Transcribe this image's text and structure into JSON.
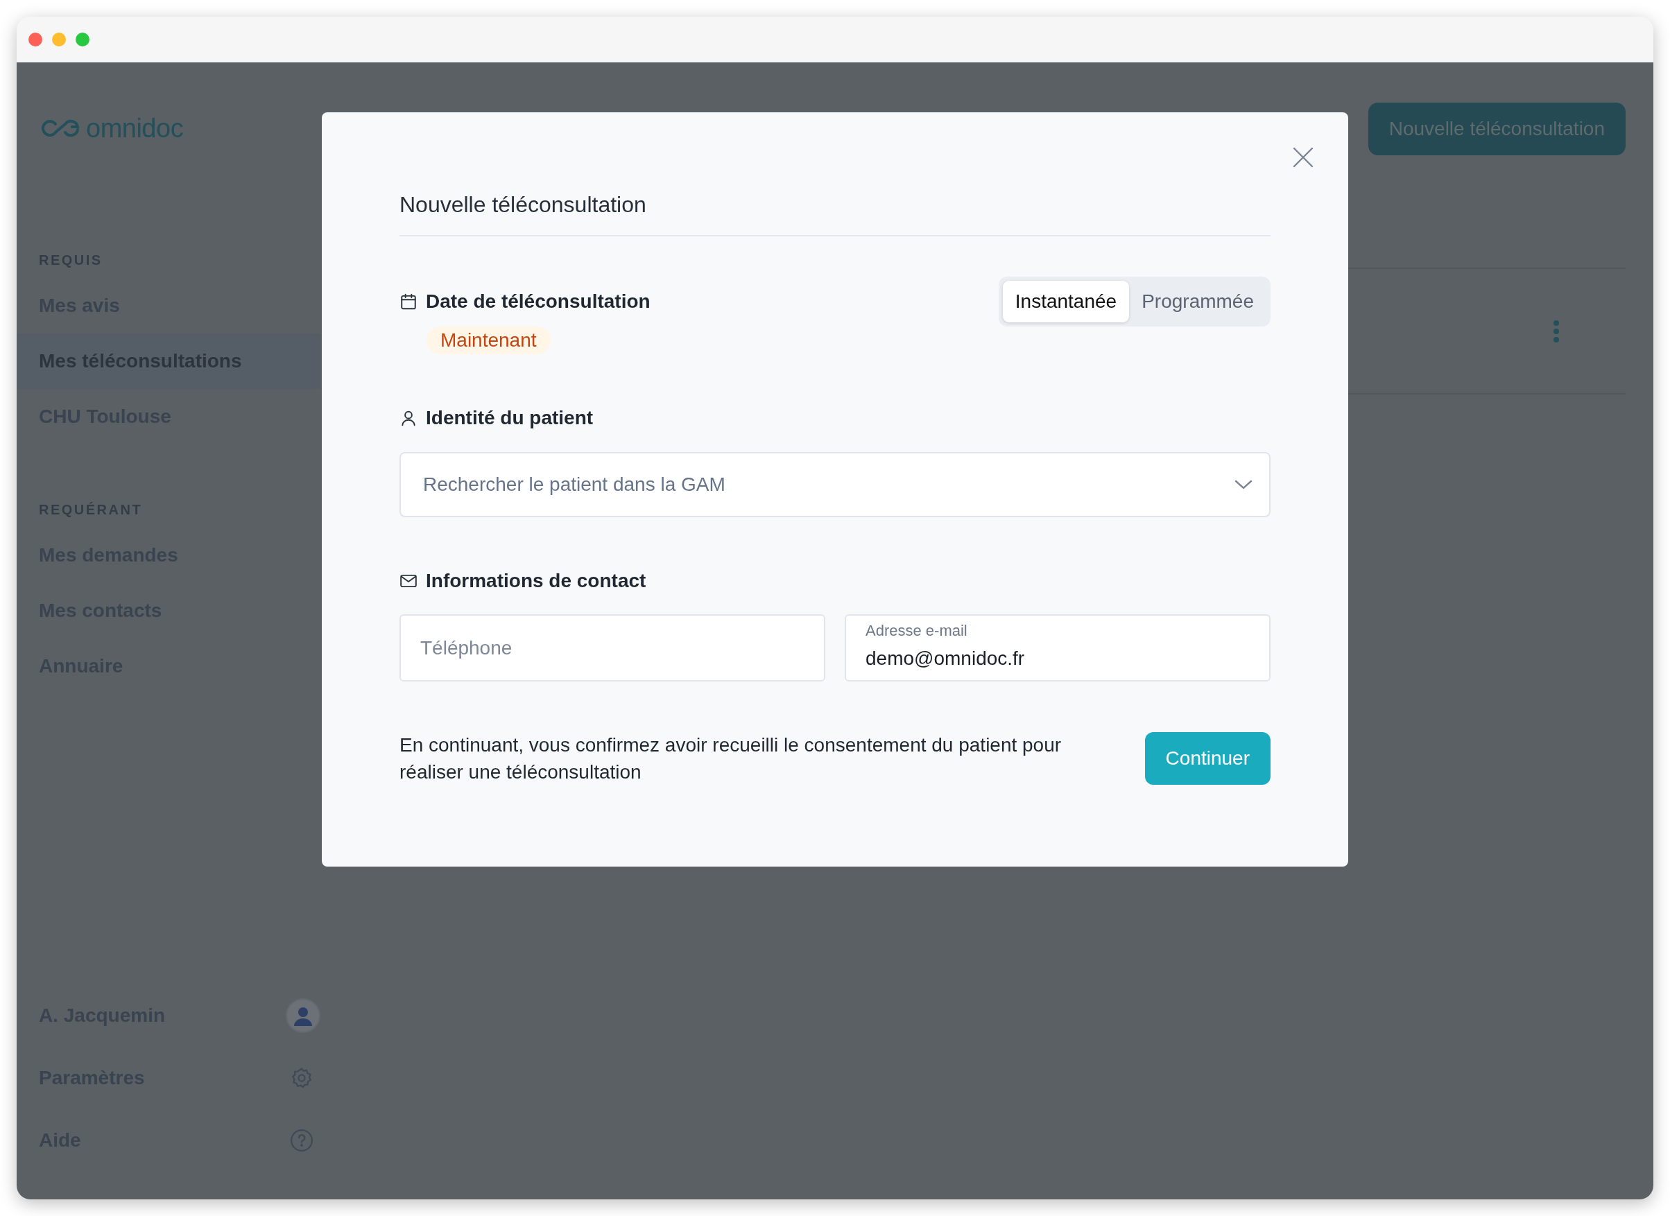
{
  "app": {
    "logo": "omnidoc",
    "new_button": "Nouvelle téléconsultation"
  },
  "sidebar": {
    "sections": [
      {
        "heading": "REQUIS",
        "items": [
          {
            "label": "Mes avis",
            "selected": false
          },
          {
            "label": "Mes téléconsultations",
            "selected": true
          },
          {
            "label": "CHU Toulouse",
            "selected": false
          }
        ]
      },
      {
        "heading": "REQUÉRANT",
        "items": [
          {
            "label": "Mes demandes",
            "selected": false
          },
          {
            "label": "Mes contacts",
            "selected": false
          },
          {
            "label": "Annuaire",
            "selected": false
          }
        ]
      }
    ],
    "footer": [
      {
        "label": "A. Jacquemin",
        "kind": "avatar"
      },
      {
        "label": "Paramètres",
        "kind": "settings"
      },
      {
        "label": "Aide",
        "kind": "help"
      }
    ]
  },
  "modal": {
    "title": "Nouvelle téléconsultation",
    "date": {
      "label": "Date de téléconsultation",
      "modes": [
        {
          "label": "Instantanée",
          "selected": true
        },
        {
          "label": "Programmée",
          "selected": false
        }
      ],
      "badge": "Maintenant"
    },
    "patient": {
      "label": "Identité du patient",
      "search": {
        "placeholder": "Rechercher le patient dans la GAM"
      }
    },
    "contact": {
      "label": "Informations de contact",
      "phone": {
        "placeholder": "Téléphone"
      },
      "email": {
        "label": "Adresse e-mail",
        "value": "demo@omnidoc.fr"
      }
    },
    "consent": "En continuant, vous confirmez avoir recueilli le consentement du patient pour réaliser une téléconsultation",
    "submit": "Continuer"
  }
}
